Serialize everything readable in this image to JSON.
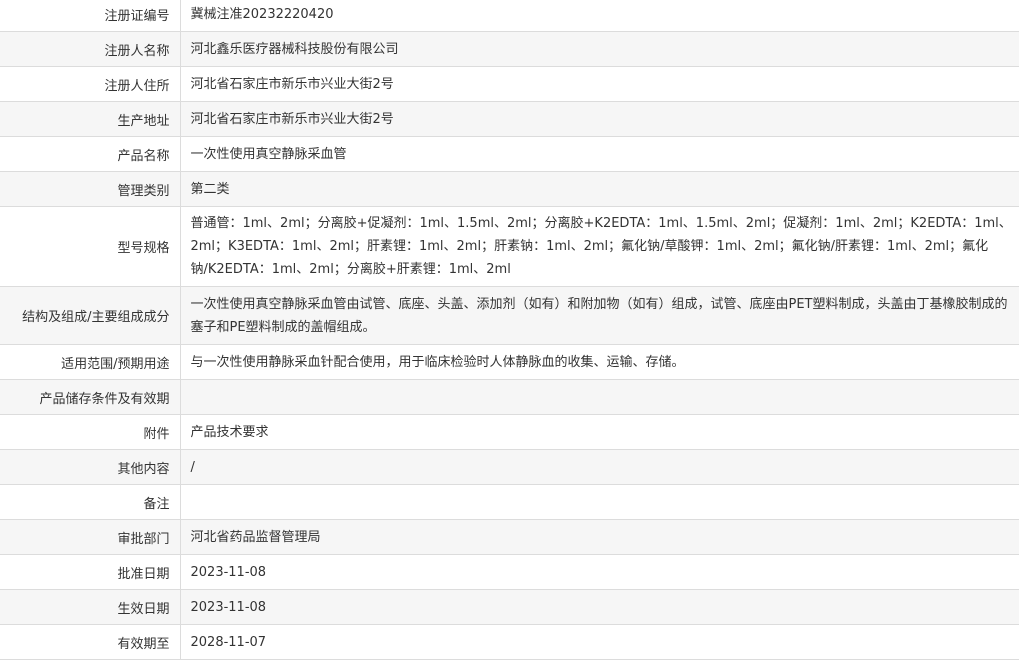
{
  "rows": [
    {
      "label": "注册证编号",
      "value": "冀械注准20232220420"
    },
    {
      "label": "注册人名称",
      "value": "河北鑫乐医疗器械科技股份有限公司"
    },
    {
      "label": "注册人住所",
      "value": "河北省石家庄市新乐市兴业大街2号"
    },
    {
      "label": "生产地址",
      "value": "河北省石家庄市新乐市兴业大街2号"
    },
    {
      "label": "产品名称",
      "value": "一次性使用真空静脉采血管"
    },
    {
      "label": "管理类别",
      "value": "第二类"
    },
    {
      "label": "型号规格",
      "value": "普通管：1ml、2ml；分离胶+促凝剂：1ml、1.5ml、2ml；分离胶+K2EDTA：1ml、1.5ml、2ml；促凝剂：1ml、2ml；K2EDTA：1ml、2ml；K3EDTA：1ml、2ml；肝素锂：1ml、2ml；肝素钠：1ml、2ml；氟化钠/草酸钾：1ml、2ml；氟化钠/肝素锂：1ml、2ml；氟化钠/K2EDTA：1ml、2ml；分离胶+肝素锂：1ml、2ml"
    },
    {
      "label": "结构及组成/主要组成成分",
      "value": "一次性使用真空静脉采血管由试管、底座、头盖、添加剂（如有）和附加物（如有）组成，试管、底座由PET塑料制成，头盖由丁基橡胶制成的塞子和PE塑料制成的盖帽组成。"
    },
    {
      "label": "适用范围/预期用途",
      "value": "与一次性使用静脉采血针配合使用，用于临床检验时人体静脉血的收集、运输、存储。"
    },
    {
      "label": "产品储存条件及有效期",
      "value": ""
    },
    {
      "label": "附件",
      "value": "产品技术要求"
    },
    {
      "label": "其他内容",
      "value": "/"
    },
    {
      "label": "备注",
      "value": ""
    },
    {
      "label": "审批部门",
      "value": "河北省药品监督管理局"
    },
    {
      "label": "批准日期",
      "value": "2023-11-08"
    },
    {
      "label": "生效日期",
      "value": "2023-11-08"
    },
    {
      "label": "有效期至",
      "value": "2028-11-07"
    }
  ]
}
